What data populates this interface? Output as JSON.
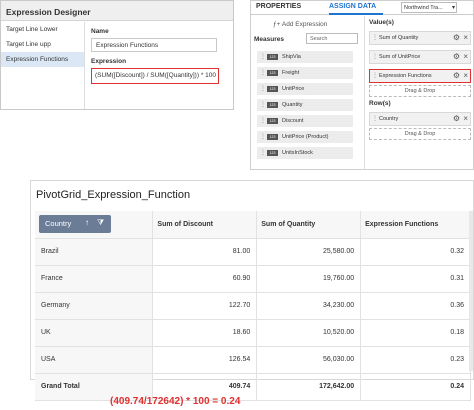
{
  "expression_designer": {
    "title": "Expression Designer",
    "list": [
      "Target Line Lower",
      "Target Line upp",
      "Expression Functions"
    ],
    "active_index": 2,
    "name_label": "Name",
    "name_value": "Expression Functions",
    "expression_label": "Expression",
    "expression_value": "(SUM([Discount]) / SUM([Quantity])) * 100"
  },
  "properties_panel": {
    "tabs": [
      "PROPERTIES",
      "ASSIGN DATA"
    ],
    "active_tab": "ASSIGN DATA",
    "datasource": "Northwind Tra...",
    "add_expression": "Add Expression",
    "measures_label": "Measures",
    "search_placeholder": "Search",
    "measures": [
      {
        "type": "123",
        "name": "ShipVia"
      },
      {
        "type": "123",
        "name": "Freight"
      },
      {
        "type": "123",
        "name": "UnitPrice"
      },
      {
        "type": "123",
        "name": "Quantity"
      },
      {
        "type": "123",
        "name": "Discount"
      },
      {
        "type": "123",
        "name": "UnitPrice (Product)"
      },
      {
        "type": "123",
        "name": "UnitsInStock"
      }
    ],
    "values_label": "Value(s)",
    "values": [
      "Sum of Quantity",
      "Sum of UnitPrice",
      "Expression Functions"
    ],
    "drag_drop": "Drag & Drop",
    "rows_label": "Row(s)",
    "rows": [
      "Country"
    ]
  },
  "pivot": {
    "title": "PivotGrid_Expression_Function",
    "row_header": "Country",
    "columns": [
      "Sum of Discount",
      "Sum of Quantity",
      "Expression Functions"
    ],
    "rows": [
      {
        "label": "Brazil",
        "values": [
          "81.00",
          "25,580.00",
          "0.32"
        ]
      },
      {
        "label": "France",
        "values": [
          "60.90",
          "19,760.00",
          "0.31"
        ]
      },
      {
        "label": "Germany",
        "values": [
          "122.70",
          "34,230.00",
          "0.36"
        ]
      },
      {
        "label": "UK",
        "values": [
          "18.60",
          "10,520.00",
          "0.18"
        ]
      },
      {
        "label": "USA",
        "values": [
          "126.54",
          "56,030.00",
          "0.23"
        ]
      }
    ],
    "total": {
      "label": "Grand Total",
      "values": [
        "409.74",
        "172,642.00",
        "0.24"
      ]
    }
  },
  "formula": "(409.74/172642) * 100 = 0.24",
  "colors": {
    "accent": "#1d74d1",
    "highlight": "#e03030",
    "chip": "#6b7d96"
  }
}
